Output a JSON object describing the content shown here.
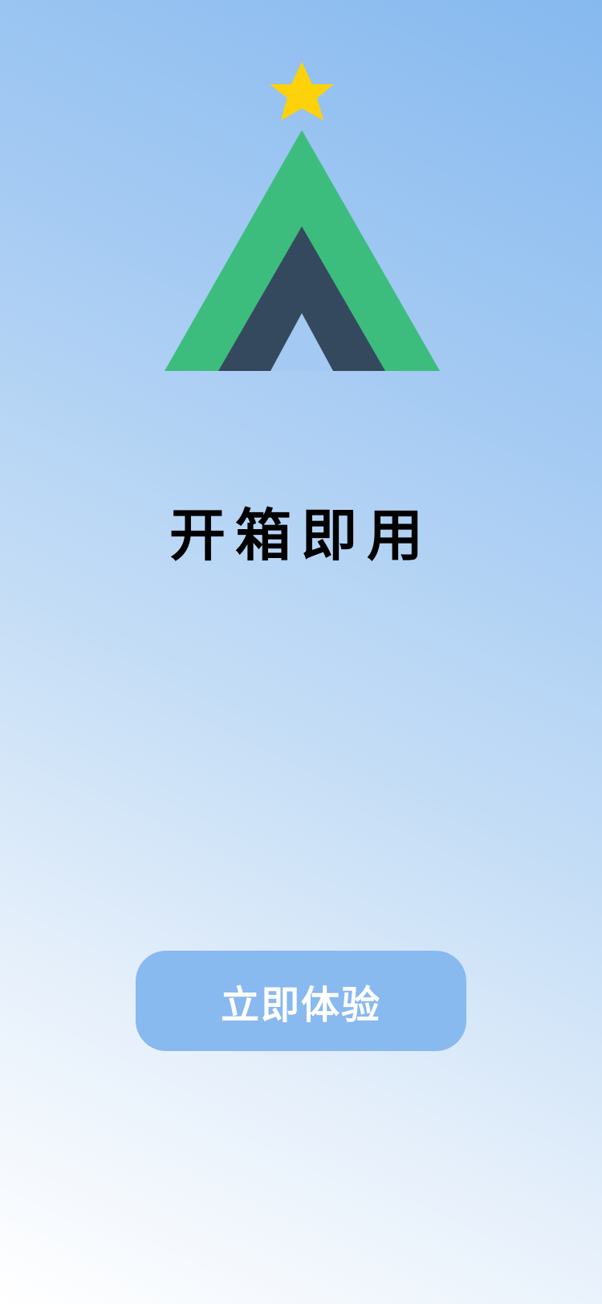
{
  "splash": {
    "logo_icon": "tree-star-logo-icon",
    "headline": "开箱即用",
    "cta_label": "立即体验"
  },
  "colors": {
    "star": "#fdd20a",
    "tree_outer": "#3dbd7d",
    "tree_inner": "#35495e",
    "button_bg": "#88b9ef",
    "button_text": "#ffffff",
    "headline_text": "#000000",
    "bg_top": "#86b9ef",
    "bg_bottom": "#ffffff"
  }
}
